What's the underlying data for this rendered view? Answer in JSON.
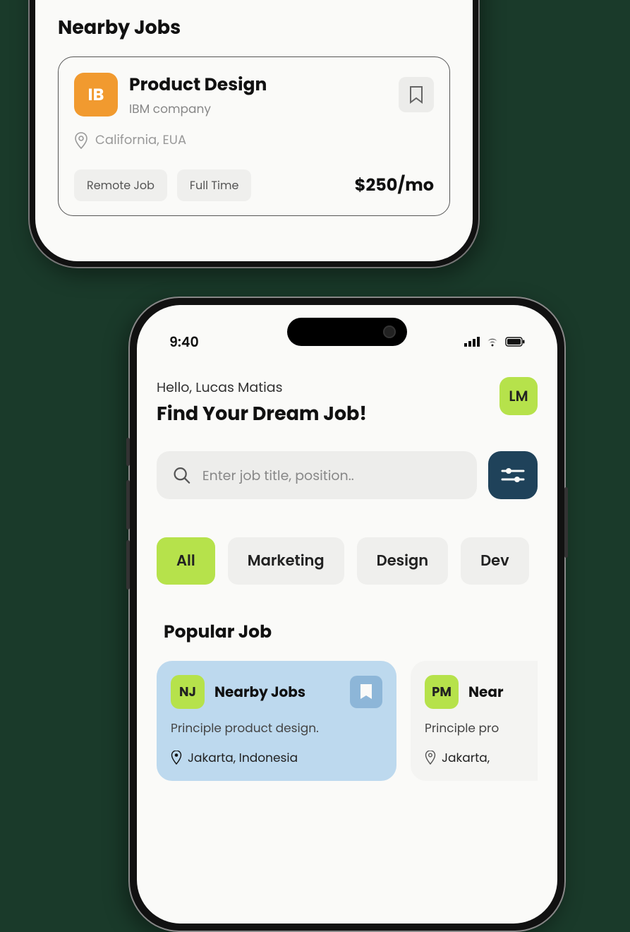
{
  "phone1": {
    "section_heading": "Nearby Jobs",
    "job": {
      "badge": "IB",
      "title": "Product Design",
      "company": "IBM company",
      "location": "California, EUA",
      "tags": [
        "Remote Job",
        "Full Time"
      ],
      "salary": "$250/mo"
    }
  },
  "phone2": {
    "status": {
      "time": "9:40"
    },
    "greeting": "Hello, Lucas Matias",
    "hero": "Find Your Dream Job!",
    "avatar": "LM",
    "search": {
      "placeholder": "Enter job title, position.."
    },
    "chips": [
      "All",
      "Marketing",
      "Design",
      "Dev"
    ],
    "active_chip_index": 0,
    "popular_heading": "Popular Job",
    "popular": [
      {
        "badge": "NJ",
        "title": "Nearby Jobs",
        "subtitle": "Principle product design.",
        "location": "Jakarta, Indonesia"
      },
      {
        "badge": "PM",
        "title": "Near",
        "subtitle": "Principle pro",
        "location": "Jakarta,"
      }
    ]
  }
}
